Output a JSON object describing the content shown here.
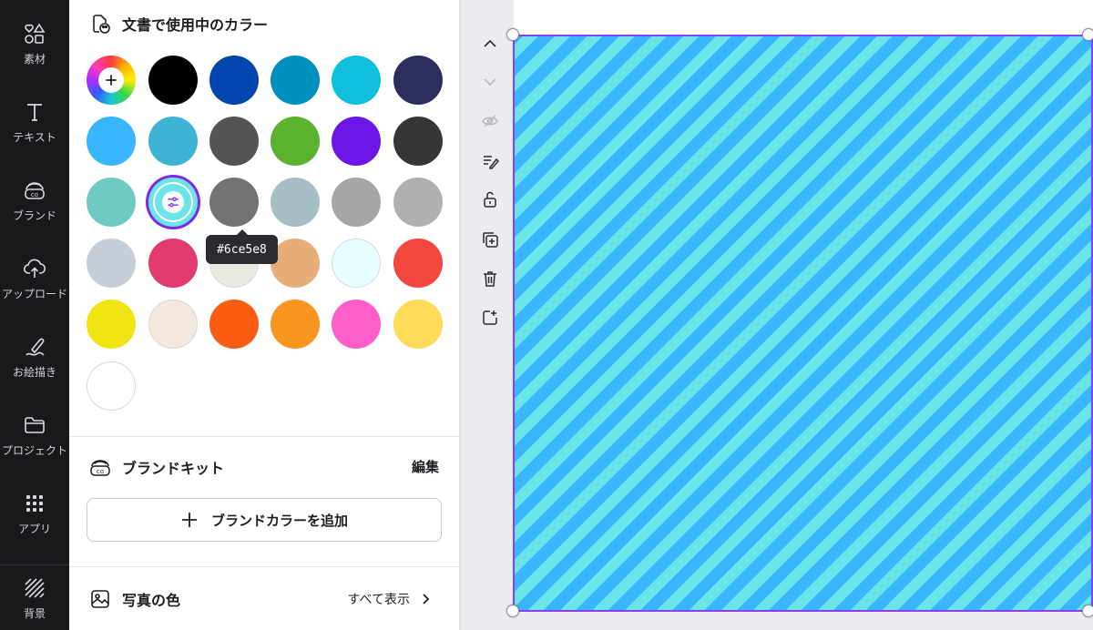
{
  "rail": {
    "items": [
      {
        "label": "素材",
        "icon": "elements-icon"
      },
      {
        "label": "テキスト",
        "icon": "text-icon"
      },
      {
        "label": "ブランド",
        "icon": "brand-icon"
      },
      {
        "label": "アップロード",
        "icon": "upload-icon"
      },
      {
        "label": "お絵描き",
        "icon": "draw-icon"
      },
      {
        "label": "プロジェクト",
        "icon": "folder-icon"
      },
      {
        "label": "アプリ",
        "icon": "apps-icon"
      },
      {
        "label": "背景",
        "icon": "background-icon"
      }
    ]
  },
  "document_colors": {
    "title": "文書で使用中のカラー",
    "swatches": [
      "#000000",
      "#0046ad",
      "#0090bf",
      "#0ebfdb",
      "#2d2d5e",
      "#38b6ff",
      "#3fb3d3",
      "#545454",
      "#5bb22d",
      "#6b16e6",
      "#363636",
      "#6dcbc3",
      "#6ce5e8",
      "#737373",
      "#a6bfc7",
      "#a6a6a6",
      "#b0b0b2",
      "#c8ced8",
      "#e13a6e",
      "#e6e9e0",
      "#e8ae79",
      "#e6fffe",
      "#f2473d",
      "#f0e513",
      "#f3e9dd",
      "#fa5c11",
      "#f7951e",
      "#ff5ec8",
      "#ffdb58",
      "#ffffff"
    ],
    "selected_hex": "#6ce5e8",
    "tooltip": "#6ce5e8"
  },
  "brand_kit": {
    "title": "ブランドキット",
    "edit_label": "編集",
    "add_button_label": "ブランドカラーを追加"
  },
  "photo_colors": {
    "title": "写真の色",
    "see_all_label": "すべて表示"
  },
  "canvas": {
    "stripe_color_a": "#6ce5e8",
    "stripe_color_b": "#38b6ff",
    "selection_color": "#8b3dff"
  }
}
